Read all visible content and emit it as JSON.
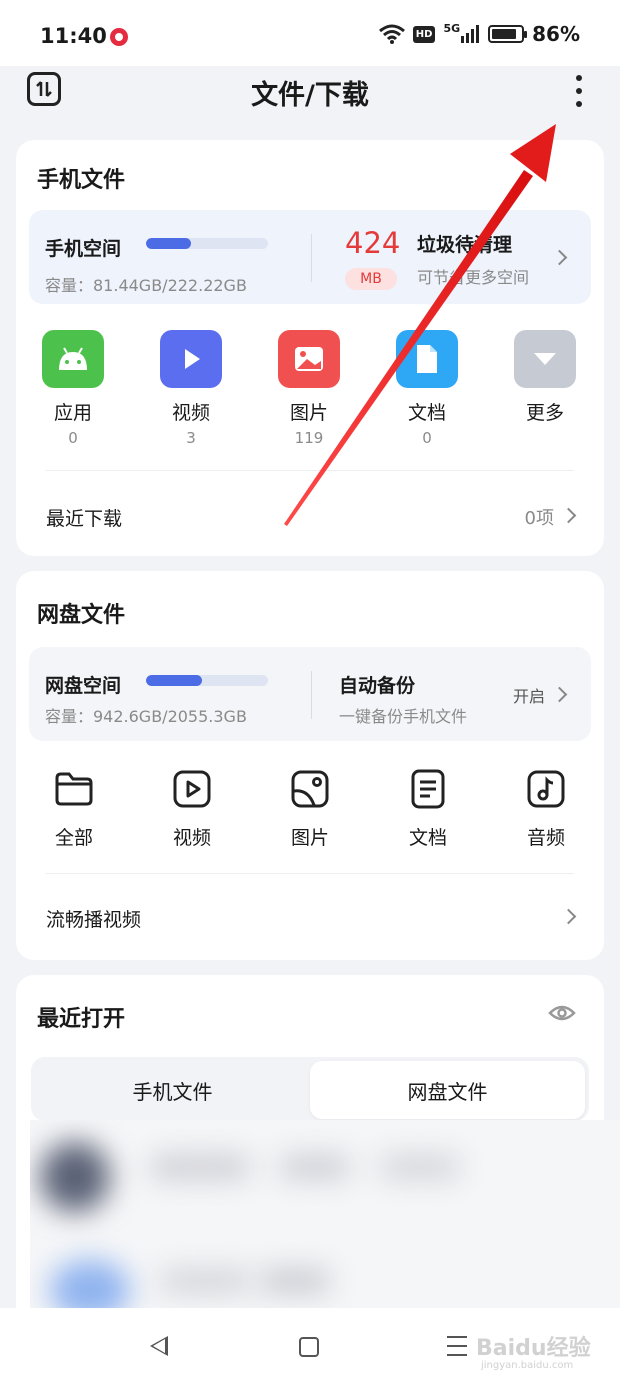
{
  "status": {
    "time": "11:40",
    "hd": "HD",
    "signal_5g": "5G",
    "battery_level": 0.86,
    "battery": "86%"
  },
  "header": {
    "title": "文件/下载"
  },
  "phone_files": {
    "title": "手机文件",
    "space_label": "手机空间",
    "space_usage": 0.37,
    "capacity": "容量：81.44GB/222.22GB",
    "junk_size": "424",
    "junk_unit": "MB",
    "junk_title": "垃圾待清理",
    "junk_sub": "可节省更多空间",
    "categories": [
      {
        "label": "应用",
        "count": "0",
        "icon": "android-icon",
        "color": "#4cc24c"
      },
      {
        "label": "视频",
        "count": "3",
        "icon": "play-icon",
        "color": "#5b6ef0"
      },
      {
        "label": "图片",
        "count": "119",
        "icon": "image-icon",
        "color": "#f15050"
      },
      {
        "label": "文档",
        "count": "0",
        "icon": "document-icon",
        "color": "#2ea8f5"
      },
      {
        "label": "更多",
        "count": "",
        "icon": "chevron-down-icon",
        "color": "#c6cad2"
      }
    ],
    "recent_downloads_label": "最近下载",
    "recent_downloads_count": "0项"
  },
  "cloud_files": {
    "title": "网盘文件",
    "space_label": "网盘空间",
    "space_usage": 0.46,
    "capacity": "容量：942.6GB/2055.3GB",
    "backup_title": "自动备份",
    "backup_sub": "一键备份手机文件",
    "backup_action": "开启",
    "categories": [
      {
        "label": "全部",
        "icon": "folder-icon"
      },
      {
        "label": "视频",
        "icon": "video-icon"
      },
      {
        "label": "图片",
        "icon": "picture-icon"
      },
      {
        "label": "文档",
        "icon": "doc-icon"
      },
      {
        "label": "音频",
        "icon": "music-icon"
      }
    ],
    "stream_label": "流畅播视频"
  },
  "recent_open": {
    "title": "最近打开",
    "tabs": [
      {
        "label": "手机文件",
        "active": false
      },
      {
        "label": "网盘文件",
        "active": true
      }
    ]
  },
  "colors": {
    "accent": "#4c6ce6",
    "junk": "#e53a3a",
    "arrow": "#e21b1b"
  },
  "watermark": {
    "text": "Baidu经验",
    "sub": "jingyan.baidu.com"
  }
}
